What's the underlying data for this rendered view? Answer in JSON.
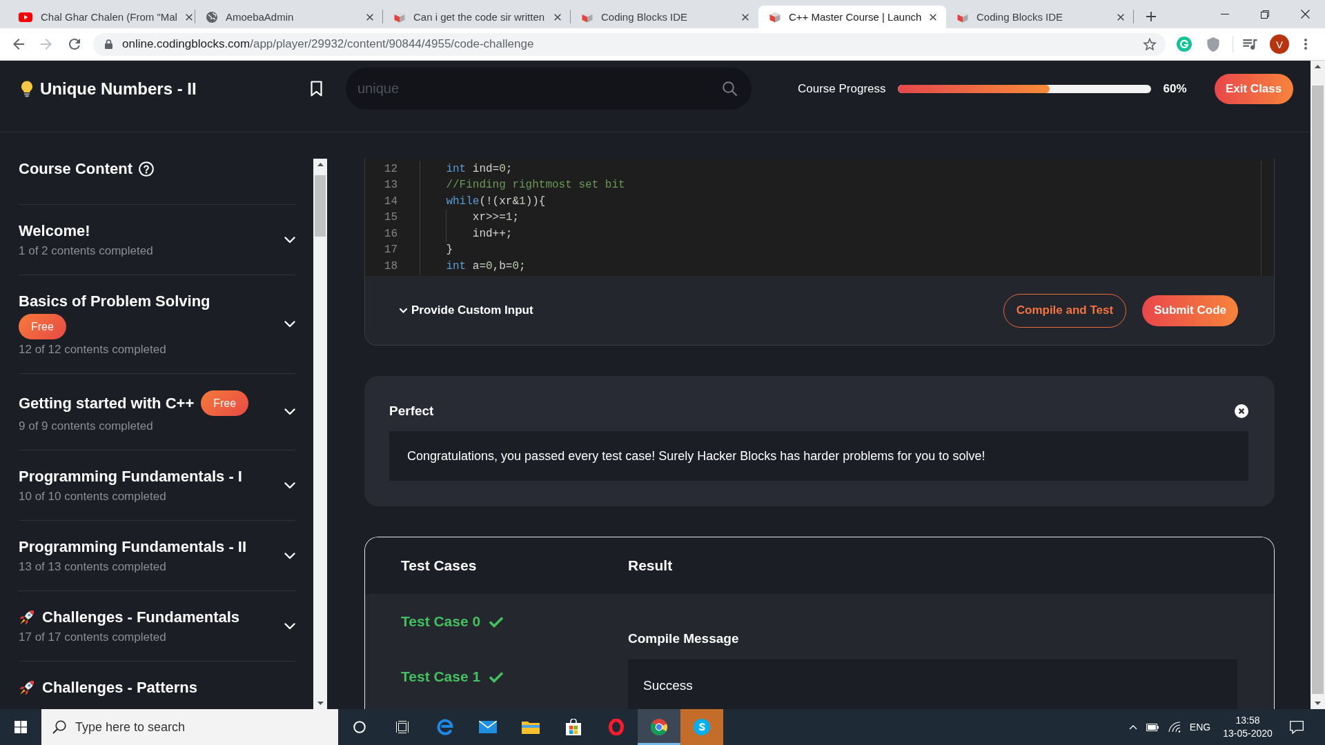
{
  "browser": {
    "tabs": [
      {
        "kind": "video",
        "title": "Chal Ghar Chalen (From \"Mal",
        "selected": false
      },
      {
        "kind": "globe",
        "title": "AmoebaAdmin",
        "selected": false
      },
      {
        "kind": "cube",
        "title": "Can i get the code sir written",
        "selected": false
      },
      {
        "kind": "cube",
        "title": "Coding Blocks IDE",
        "selected": false
      },
      {
        "kind": "cube",
        "title": "C++ Master Course | Launch",
        "selected": true
      },
      {
        "kind": "cube",
        "title": "Coding Blocks IDE",
        "selected": false
      }
    ],
    "forward_disabled": true,
    "url_host": "online.codingblocks.com",
    "url_path": "/app/player/29932/content/90844/4955/code-challenge",
    "profile_initial": "V"
  },
  "header": {
    "title": "Unique Numbers - II",
    "search": {
      "value": "unique"
    },
    "progress": {
      "label": "Course Progress",
      "level": 0.6,
      "reading": "60%"
    },
    "exit_button": "Exit Class"
  },
  "sidebar": {
    "title": "Course Content",
    "sections": [
      {
        "kind": "chapter",
        "title": "Welcome!",
        "summary": "1 of 2 contents completed",
        "expanded": false
      },
      {
        "kind": "chapter",
        "title": "Basics of Problem Solving",
        "badge": "Free",
        "summary": "12 of 12 contents completed",
        "expanded": false
      },
      {
        "kind": "chapter",
        "title": "Getting started with C++",
        "badge": "Free",
        "summary": "9 of 9 contents completed",
        "expanded": false
      },
      {
        "kind": "chapter",
        "title": "Programming Fundamentals - I",
        "summary": "10 of 10 contents completed",
        "expanded": false
      },
      {
        "kind": "chapter",
        "title": "Programming Fundamentals - II",
        "summary": "13 of 13 contents completed",
        "expanded": false
      },
      {
        "kind": "challenge",
        "title": "Challenges - Fundamentals",
        "summary": "17 of 17 contents completed",
        "expanded": false
      },
      {
        "kind": "challenge",
        "title": "Challenges - Patterns"
      }
    ]
  },
  "editor": {
    "lines": [
      {
        "number": "12",
        "tokens": [
          {
            "kind": "keyword",
            "text": "    int"
          },
          {
            "kind": "plain",
            "text": " ind="
          },
          {
            "kind": "number",
            "text": "0"
          },
          {
            "kind": "plain",
            "text": ";"
          }
        ]
      },
      {
        "number": "13",
        "tokens": [
          {
            "kind": "comment",
            "text": "    //Finding rightmost set bit"
          }
        ]
      },
      {
        "number": "14",
        "tokens": [
          {
            "kind": "keyword",
            "text": "    while"
          },
          {
            "kind": "plain",
            "text": "(!(xr&"
          },
          {
            "kind": "number",
            "text": "1"
          },
          {
            "kind": "plain",
            "text": ")){"
          }
        ]
      },
      {
        "number": "15",
        "tokens": [
          {
            "kind": "plain",
            "text": "        xr>>="
          },
          {
            "kind": "number",
            "text": "1"
          },
          {
            "kind": "plain",
            "text": ";"
          }
        ]
      },
      {
        "number": "16",
        "tokens": [
          {
            "kind": "plain",
            "text": "        ind++;"
          }
        ]
      },
      {
        "number": "17",
        "tokens": [
          {
            "kind": "plain",
            "text": "    }"
          }
        ]
      },
      {
        "number": "18",
        "tokens": [
          {
            "kind": "keyword",
            "text": "    int"
          },
          {
            "kind": "plain",
            "text": " a="
          },
          {
            "kind": "number",
            "text": "0"
          },
          {
            "kind": "plain",
            "text": ",b="
          },
          {
            "kind": "number",
            "text": "0"
          },
          {
            "kind": "plain",
            "text": ";"
          }
        ]
      }
    ],
    "custom_input": "Provide Custom Input",
    "compile_button": "Compile and Test",
    "submit_button": "Submit Code"
  },
  "verdict": {
    "title": "Perfect",
    "message": "Congratulations, you passed every test case! Surely Hacker Blocks has harder problems for you to solve!"
  },
  "results": {
    "columns": [
      "Test Cases",
      "Result"
    ],
    "test_cases": [
      {
        "name": "Test Case 0",
        "passed": true
      },
      {
        "name": "Test Case 1",
        "passed": true
      }
    ],
    "compile_heading": "Compile Message",
    "compile_output": "Success"
  },
  "taskbar": {
    "search": {
      "placeholder": "Type here to search"
    },
    "apps": [
      {
        "kind": "ring",
        "selected": false,
        "flashing": false
      },
      {
        "kind": "panels",
        "selected": false,
        "flashing": false
      },
      {
        "kind": "swirl",
        "selected": false,
        "flashing": false
      },
      {
        "kind": "envelope",
        "selected": false,
        "flashing": false
      },
      {
        "kind": "folder",
        "selected": false,
        "flashing": false
      },
      {
        "kind": "bag",
        "selected": false,
        "flashing": false
      },
      {
        "kind": "red-ring",
        "selected": false,
        "flashing": false
      },
      {
        "kind": "pinwheel",
        "selected": true,
        "flashing": false
      },
      {
        "kind": "wave",
        "selected": false,
        "flashing": true
      }
    ],
    "language": "ENG",
    "time": "13:58",
    "date": "13-05-2020"
  }
}
